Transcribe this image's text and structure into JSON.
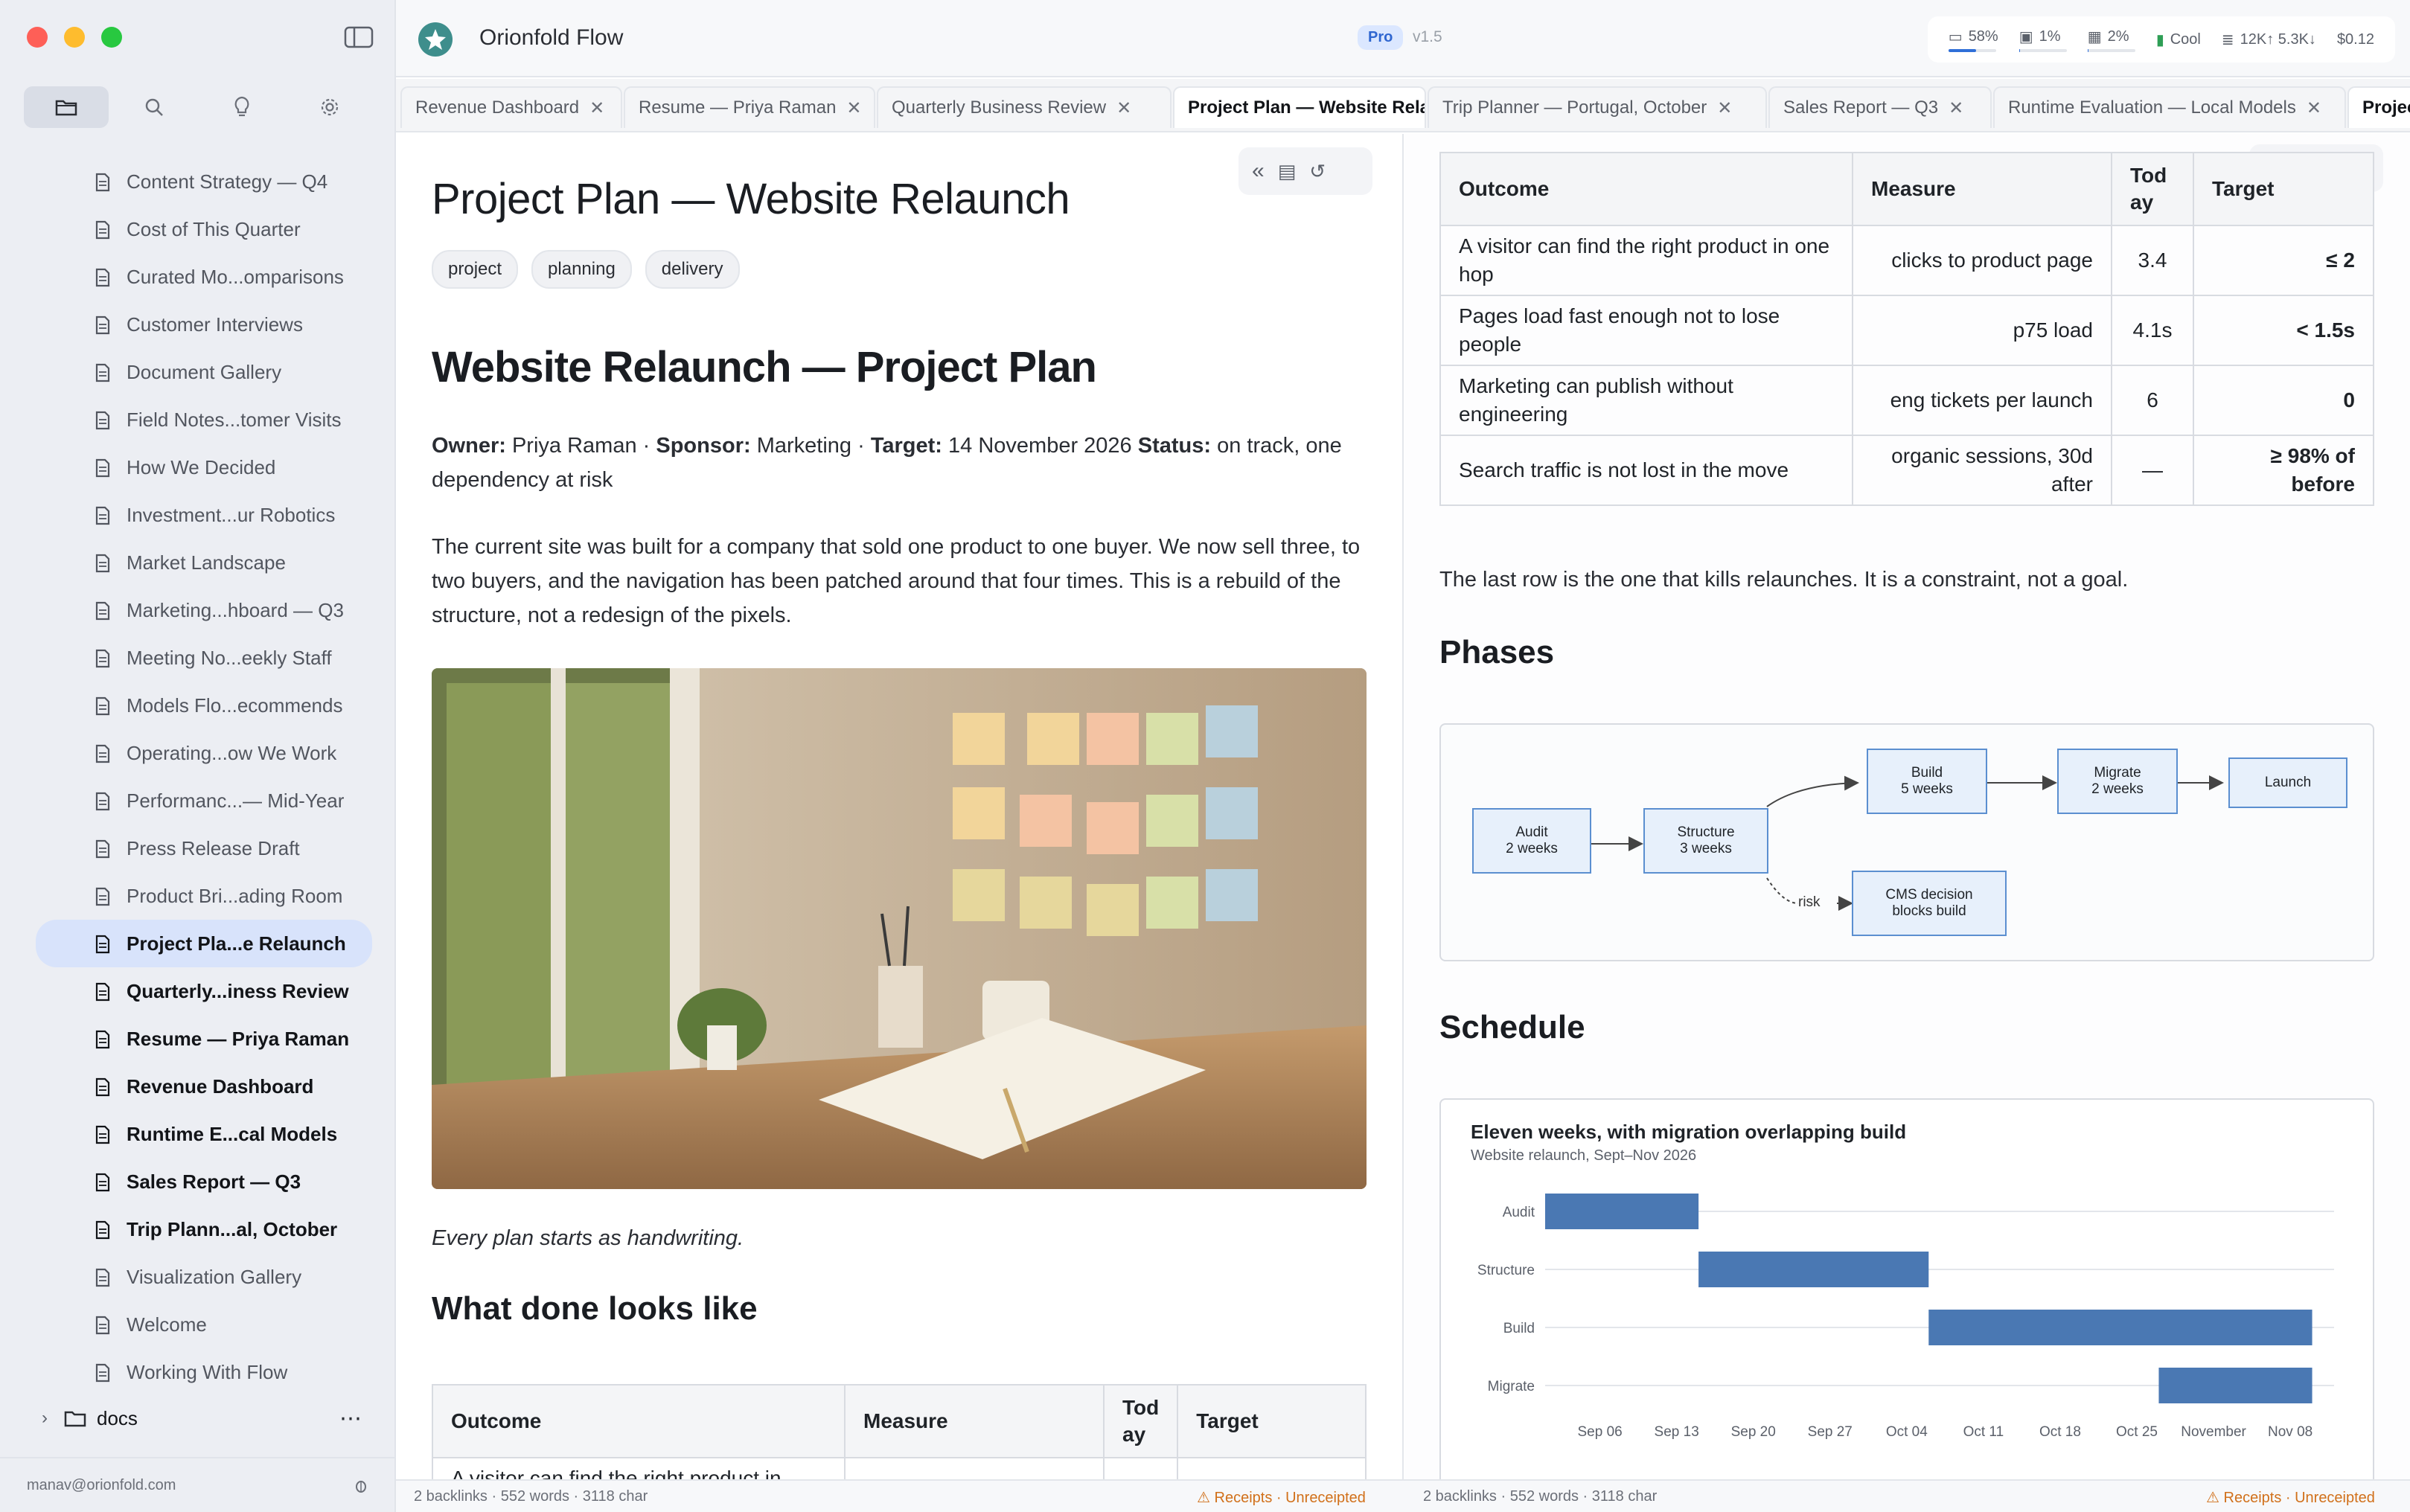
{
  "app": {
    "title": "Orionfold Flow",
    "badge": "Pro",
    "version": "v1.5"
  },
  "stats": [
    {
      "icon": "display-icon",
      "label": "58%",
      "fill": 0.58
    },
    {
      "icon": "cpu-icon",
      "label": "1%",
      "fill": 0.01
    },
    {
      "icon": "memory-icon",
      "label": "2%",
      "fill": 0.02
    },
    {
      "icon": "thermometer-icon",
      "label": "Cool"
    },
    {
      "icon": "tokens-icon",
      "label": "12K↑ 5.3K↓"
    },
    {
      "icon": "cost-icon",
      "label": "$0.12"
    }
  ],
  "sidebar": {
    "items": [
      {
        "label": "Content Strategy — Q4",
        "style": "normal"
      },
      {
        "label": "Cost of This Quarter",
        "style": "normal"
      },
      {
        "label": "Curated Mo...omparisons",
        "style": "normal"
      },
      {
        "label": "Customer Interviews",
        "style": "normal"
      },
      {
        "label": "Document Gallery",
        "style": "normal"
      },
      {
        "label": "Field Notes...tomer Visits",
        "style": "normal"
      },
      {
        "label": "How We Decided",
        "style": "normal"
      },
      {
        "label": "Investment...ur Robotics",
        "style": "normal"
      },
      {
        "label": "Market Landscape",
        "style": "normal"
      },
      {
        "label": "Marketing...hboard — Q3",
        "style": "normal"
      },
      {
        "label": "Meeting No...eekly Staff",
        "style": "normal"
      },
      {
        "label": "Models Flo...ecommends",
        "style": "normal"
      },
      {
        "label": "Operating...ow We Work",
        "style": "normal"
      },
      {
        "label": "Performanc...— Mid-Year",
        "style": "normal"
      },
      {
        "label": "Press Release Draft",
        "style": "normal"
      },
      {
        "label": "Product Bri...ading Room",
        "style": "normal"
      },
      {
        "label": "Project Pla...e Relaunch",
        "style": "active"
      },
      {
        "label": "Quarterly...iness Review",
        "style": "bold"
      },
      {
        "label": "Resume — Priya Raman",
        "style": "bold"
      },
      {
        "label": "Revenue Dashboard",
        "style": "bold"
      },
      {
        "label": "Runtime E...cal Models",
        "style": "bold"
      },
      {
        "label": "Sales Report — Q3",
        "style": "bold"
      },
      {
        "label": "Trip Plann...al, October",
        "style": "bold"
      },
      {
        "label": "Visualization Gallery",
        "style": "normal"
      },
      {
        "label": "Welcome",
        "style": "normal"
      },
      {
        "label": "Working With Flow",
        "style": "normal"
      }
    ],
    "folder": "docs",
    "footer_email": "manav@orionfold.com"
  },
  "tabs": [
    {
      "label": "Revenue Dashboard",
      "active": false
    },
    {
      "label": "Resume — Priya Raman",
      "active": false
    },
    {
      "label": "Quarterly Business Review",
      "active": false
    },
    {
      "label": "Project Plan — Website Relaunch",
      "active": true
    },
    {
      "label": "Trip Planner — Portugal, October",
      "active": false
    },
    {
      "label": "Sales Report — Q3",
      "active": false
    },
    {
      "label": "Runtime Evaluation — Local Models",
      "active": false
    },
    {
      "label": "Project Plan — Website Relaunch",
      "active": true
    }
  ],
  "doc": {
    "title": "Project Plan — Website Relaunch",
    "tags": [
      "project",
      "planning",
      "delivery"
    ],
    "heading": "Website Relaunch — Project Plan",
    "owner_label": "Owner:",
    "owner": "Priya Raman",
    "sponsor_label": "Sponsor:",
    "sponsor": "Marketing",
    "target_label": "Target:",
    "target": "14 November 2026",
    "status_label": "Status:",
    "status": "on track, one dependency at risk",
    "intro": "The current site was built for a company that sold one product to one buyer. We now sell three, to two buyers, and the navigation has been patched around that four times. This is a rebuild of the structure, not a redesign of the pixels.",
    "caption": "Every plan starts as handwriting.",
    "done_heading": "What done looks like",
    "table": {
      "headers": [
        "Outcome",
        "Measure",
        "Tod ay",
        "Target"
      ],
      "rows": [
        [
          "A visitor can find the right product in one hop",
          "clicks to product page",
          "3.4",
          "≤ 2"
        ],
        [
          "Pages load fast enough not to lose people",
          "p75 load",
          "4.1s",
          "< 1.5s"
        ],
        [
          "Marketing can publish without engineering",
          "eng tickets per launch",
          "6",
          "0"
        ],
        [
          "Search traffic is not lost in the move",
          "organic sessions, 30d after",
          "—",
          "≥ 98% of before"
        ]
      ],
      "left_first_row_fragment": "A visitor can find the right product in"
    },
    "table_note": "The last row is the one that kills relaunches. It is a constraint, not a goal.",
    "phases_heading": "Phases",
    "phases": [
      {
        "id": "audit",
        "label": "Audit",
        "sub": "2 weeks"
      },
      {
        "id": "structure",
        "label": "Structure",
        "sub": "3 weeks"
      },
      {
        "id": "build",
        "label": "Build",
        "sub": "5 weeks"
      },
      {
        "id": "migrate",
        "label": "Migrate",
        "sub": "2 weeks"
      },
      {
        "id": "launch",
        "label": "Launch",
        "sub": ""
      },
      {
        "id": "cms",
        "label": "CMS decision",
        "sub": "blocks build"
      }
    ],
    "risk_label": "risk",
    "schedule_heading": "Schedule"
  },
  "chart_data": {
    "type": "gantt",
    "title": "Eleven weeks, with migration overlapping build",
    "subtitle": "Website relaunch, Sept–Nov 2026",
    "tasks": [
      {
        "name": "Audit",
        "start": "2026-09-01",
        "end": "2026-09-15"
      },
      {
        "name": "Structure",
        "start": "2026-09-15",
        "end": "2026-10-06"
      },
      {
        "name": "Build",
        "start": "2026-10-06",
        "end": "2026-11-10"
      },
      {
        "name": "Migrate",
        "start": "2026-10-27",
        "end": "2026-11-10"
      }
    ],
    "x_ticks": [
      "Sep 06",
      "Sep 13",
      "Sep 20",
      "Sep 27",
      "Oct 04",
      "Oct 11",
      "Oct 18",
      "Oct 25",
      "November",
      "Nov 08"
    ],
    "bar_color": "#4a78b3"
  },
  "status": {
    "left": "2 backlinks · 552 words · 3118 char",
    "left_right": "Receipts · Unreceipted",
    "right": "2 backlinks · 552 words · 3118 char",
    "right_right": "Receipts · Unreceipted"
  },
  "colors": {
    "accent": "#2f6fd8",
    "active_item_bg": "#d8e3fb",
    "warn": "#d1701a"
  }
}
